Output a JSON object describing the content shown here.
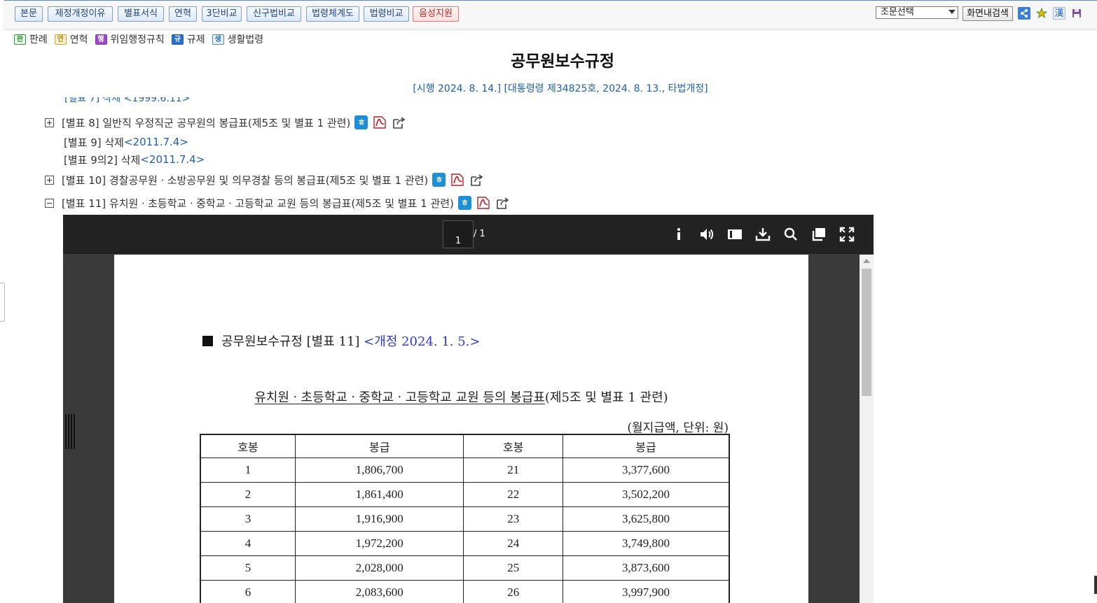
{
  "toolbar": {
    "buttons": [
      "본문",
      "제정개정이유",
      "별표서식",
      "연혁",
      "3단비교",
      "신구법비교",
      "법령체계도",
      "법령비교",
      "음성지원"
    ],
    "select_label": "조문선택",
    "search_label": "화면내검색",
    "icons": [
      "share-icon",
      "bookmark-star-icon",
      "hanja-icon",
      "save-icon"
    ],
    "hanja": "漢"
  },
  "legend": {
    "items": [
      {
        "badge": "판",
        "label": "판례",
        "color": "#2e9a3a"
      },
      {
        "badge": "연",
        "label": "연혁",
        "color": "#d8a21c"
      },
      {
        "badge": "행",
        "label": "위임행정규칙",
        "color": "#8a3ab9"
      },
      {
        "badge": "규",
        "label": "규제",
        "color": "#1f5fc4"
      },
      {
        "badge": "생",
        "label": "생활법령",
        "color": "#4a8ad0"
      }
    ]
  },
  "law": {
    "title": "공무원보수규정",
    "enforcement": "[시행 2024. 8. 14.] [대통령령 제34825호, 2024. 8. 13., 타법개정]",
    "cut_line": "[별표 7] 삭제 <1999.6.11>"
  },
  "annex": [
    {
      "expander": "+",
      "label": "[별표 8] 일반직 우정직군 공무원의 봉급표(제5조 및 별표 1 관련)",
      "date": "",
      "icons": true
    },
    {
      "expander": "",
      "label": "[별표 9] 삭제 ",
      "date": "<2011.7.4>",
      "icons": false
    },
    {
      "expander": "",
      "label": "[별표 9의2] 삭제 ",
      "date": "<2011.7.4>",
      "icons": false
    },
    {
      "expander": "+",
      "label": "[별표 10] 경찰공무원ㆍ소방공무원 및 의무경찰 등의 봉급표(제5조 및 별표 1 관련)",
      "date": "",
      "icons": true
    },
    {
      "expander": "-",
      "label": "[별표 11] 유치원ㆍ초등학교ㆍ중학교ㆍ고등학교 교원 등의 봉급표(제5조 및 별표 1 관련)",
      "date": "",
      "icons": true
    }
  ],
  "viewer": {
    "page_current": "1",
    "page_total": "/ 1",
    "toolbar_icons": [
      "info-icon",
      "volume-icon",
      "sidebar-icon",
      "download-icon",
      "search-icon",
      "copy-icon",
      "fullscreen-icon"
    ]
  },
  "document": {
    "heading": "공무원보수규정 [별표 11] ",
    "revision": "<개정 2024. 1. 5.>",
    "caption_underlined": "유치원ㆍ초등학교ㆍ중학교ㆍ고등학교 교원 등의 봉급표",
    "caption_rest": "(제5조 및 별표 1 관련)",
    "unit": "(월지급액, 단위: 원)",
    "table": {
      "headers": [
        "호봉",
        "봉급",
        "호봉",
        "봉급"
      ],
      "rows": [
        [
          "1",
          "1,806,700",
          "21",
          "3,377,600"
        ],
        [
          "2",
          "1,861,400",
          "22",
          "3,502,200"
        ],
        [
          "3",
          "1,916,900",
          "23",
          "3,625,800"
        ],
        [
          "4",
          "1,972,200",
          "24",
          "3,749,800"
        ],
        [
          "5",
          "2,028,000",
          "25",
          "3,873,600"
        ],
        [
          "6",
          "2,083,600",
          "26",
          "3,997,900"
        ]
      ]
    }
  },
  "colors": {
    "link": "#1c5fae",
    "viewer_bar": "#222222",
    "revision": "#2b39d6"
  }
}
